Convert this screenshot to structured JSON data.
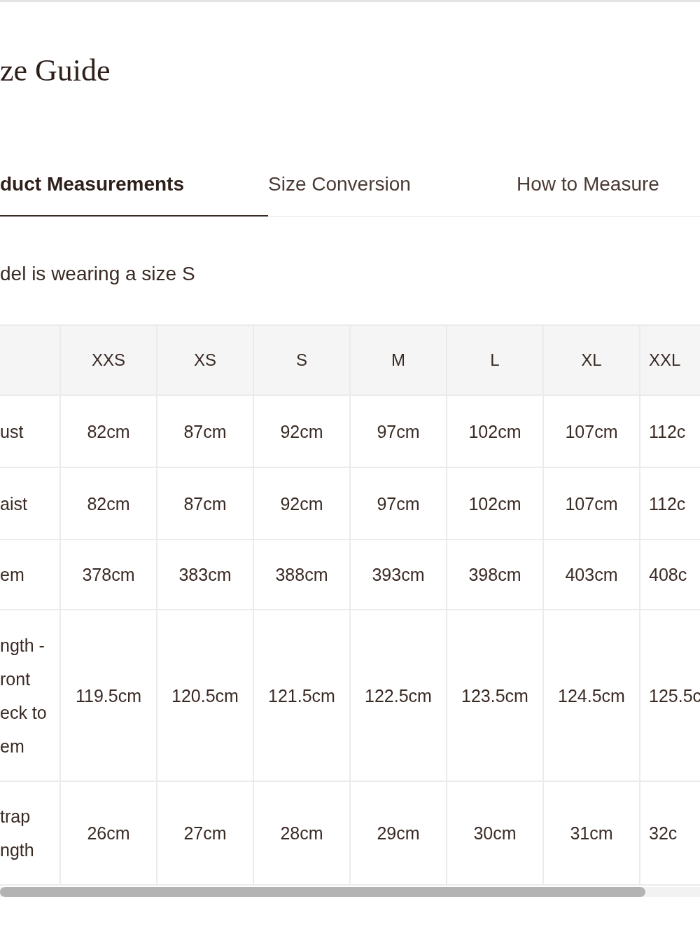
{
  "title": "ze Guide",
  "tabs": [
    {
      "label": "duct Measurements",
      "selected": true
    },
    {
      "label": "Size Conversion",
      "selected": false
    },
    {
      "label": "How to Measure",
      "selected": false
    }
  ],
  "note": "del is wearing a size S",
  "table": {
    "columns": [
      "",
      "XXS",
      "XS",
      "S",
      "M",
      "L",
      "XL",
      "XXL"
    ],
    "rows": [
      [
        "ust",
        "82cm",
        "87cm",
        "92cm",
        "97cm",
        "102cm",
        "107cm",
        "112c"
      ],
      [
        "aist",
        "82cm",
        "87cm",
        "92cm",
        "97cm",
        "102cm",
        "107cm",
        "112c"
      ],
      [
        "em",
        "378cm",
        "383cm",
        "388cm",
        "393cm",
        "398cm",
        "403cm",
        "408c"
      ],
      [
        "ngth -\nront\neck to\nem",
        "119.5cm",
        "120.5cm",
        "121.5cm",
        "122.5cm",
        "123.5cm",
        "124.5cm",
        "125.5c"
      ],
      [
        "trap\nngth",
        "26cm",
        "27cm",
        "28cm",
        "29cm",
        "30cm",
        "31cm",
        "32c"
      ]
    ]
  }
}
